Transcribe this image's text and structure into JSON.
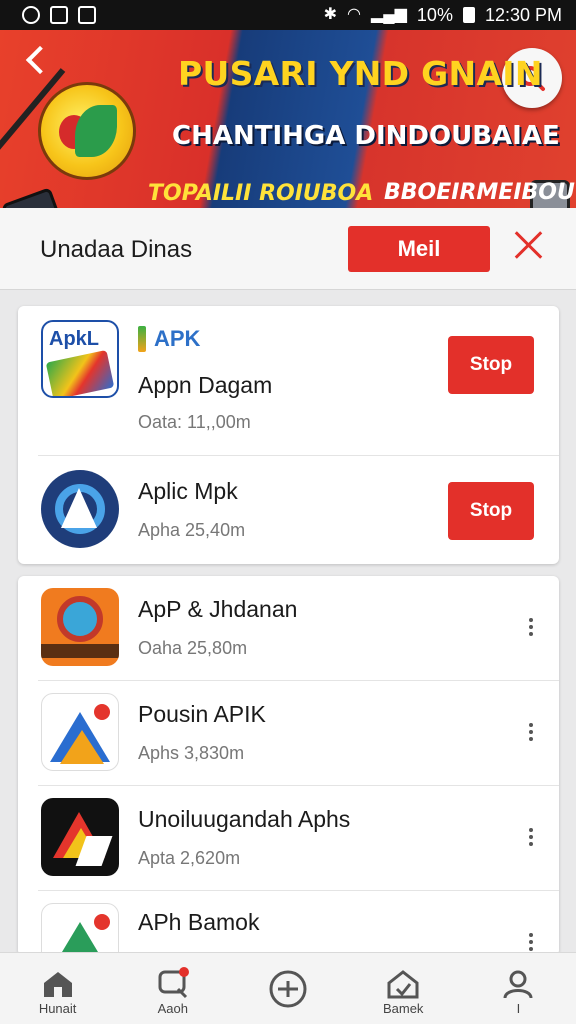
{
  "status_bar": {
    "battery": "10%",
    "time": "12:30 PM"
  },
  "banner": {
    "title_line1": "PUSARI YND GNAIN",
    "title_line2": "CHANTIHGA DINDOUBAIAE",
    "tag_left": "TOPAILII ROIUBOA",
    "tag_right": "BBOEIRMEIBOU"
  },
  "header": {
    "title": "Unadaa Dinas",
    "main_button": "Meil"
  },
  "card1": {
    "items": [
      {
        "icon_label": "ApkL",
        "tag": "APK",
        "name": "Appn Dagam",
        "meta": "Oata: 11,,00m",
        "action": "Stop"
      },
      {
        "name": "Aplic Mpk",
        "meta": "Apha 25,40m",
        "action": "Stop"
      }
    ]
  },
  "card2": {
    "items": [
      {
        "name": "ApP & Jhdanan",
        "meta": "Oaha 25,80m"
      },
      {
        "name": "Pousin APIK",
        "meta": "Aphs 3,830m"
      },
      {
        "name": "Unoiluugandah Aphs",
        "meta": "Apta 2,620m"
      },
      {
        "name": "APh Bamok",
        "meta": ""
      }
    ]
  },
  "bottom_nav": [
    {
      "label": "Hunait",
      "icon": "home-icon"
    },
    {
      "label": "Aaoh",
      "icon": "search-badge-icon"
    },
    {
      "label": "",
      "icon": "add-circle-icon"
    },
    {
      "label": "Bamek",
      "icon": "house-outline-icon"
    },
    {
      "label": "I",
      "icon": "profile-icon"
    }
  ],
  "colors": {
    "accent": "#e3302a",
    "banner_blue": "#1f4e96",
    "banner_yellow": "#ffd320"
  }
}
